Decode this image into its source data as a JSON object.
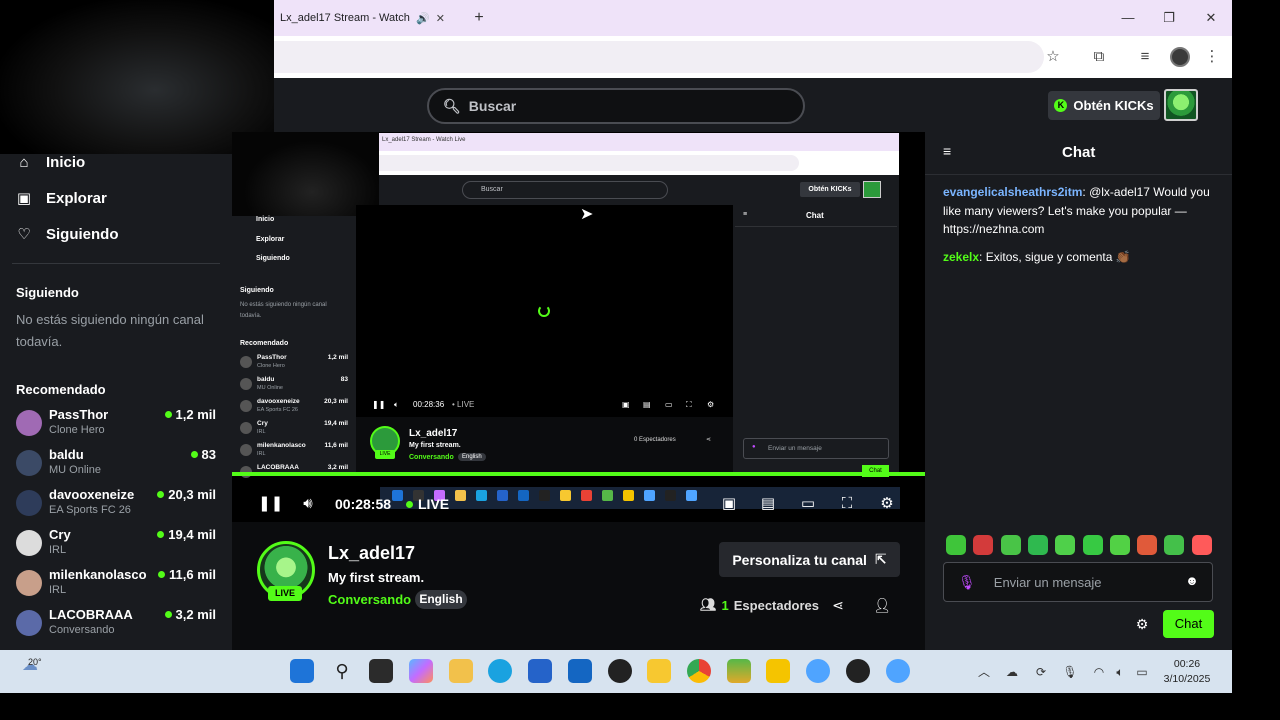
{
  "browser": {
    "tab_title": "Lx_adel17 Stream - Watch L",
    "tab_audio_icon": "speaker-icon",
    "close_glyph": "✕",
    "new_tab_glyph": "+",
    "min_glyph": "—",
    "restore_glyph": "❐",
    "winclose_glyph": "✕"
  },
  "header": {
    "search_placeholder": "Buscar",
    "kicks_label": "Obtén KICKs"
  },
  "sidebar": {
    "nav": [
      {
        "label": "Inicio",
        "icon": "home-icon"
      },
      {
        "label": "Explorar",
        "icon": "compass-icon"
      },
      {
        "label": "Siguiendo",
        "icon": "heart-icon"
      }
    ],
    "following_title": "Siguiendo",
    "following_empty": "No estás siguiendo ningún canal todavía.",
    "recommended_title": "Recomendado",
    "recommended": [
      {
        "name": "PassThor",
        "category": "Clone Hero",
        "viewers": "1,2 mil",
        "color": "#a06ab4"
      },
      {
        "name": "baldu",
        "category": "MU Online",
        "viewers": "83",
        "color": "#3b4a66"
      },
      {
        "name": "davooxeneize",
        "category": "EA Sports FC 26",
        "viewers": "20,3 mil",
        "color": "#2e3c5a"
      },
      {
        "name": "Cry",
        "category": "IRL",
        "viewers": "19,4 mil",
        "color": "#dcdcdc"
      },
      {
        "name": "milenkanolasco",
        "category": "IRL",
        "viewers": "11,6 mil",
        "color": "#c89f8a"
      },
      {
        "name": "LACOBRAAA",
        "category": "Conversando",
        "viewers": "3,2 mil",
        "color": "#5b6aa8"
      }
    ]
  },
  "player": {
    "time": "00:28:58",
    "live_label": "LIVE",
    "nested": {
      "tab_title": "Lx_adel17 Stream - Watch Live",
      "search": "Buscar",
      "kicks": "Obtén KICKs",
      "nav": [
        "Inicio",
        "Explorar",
        "Siguiendo"
      ],
      "following_title": "Siguiendo",
      "following_empty_1": "No estás siguiendo ningún canal",
      "following_empty_2": "todavía.",
      "recommended_title": "Recomendado",
      "rec": [
        {
          "name": "PassThor",
          "cat": "Clone Hero",
          "v": "1,2 mil"
        },
        {
          "name": "baldu",
          "cat": "MU Online",
          "v": "83"
        },
        {
          "name": "davooxeneize",
          "cat": "EA Sports FC 26",
          "v": "20,3 mil"
        },
        {
          "name": "Cry",
          "cat": "IRL",
          "v": "19,4 mil"
        },
        {
          "name": "milenkanolasco",
          "cat": "IRL",
          "v": "11,6 mil"
        },
        {
          "name": "LACOBRAAA",
          "cat": "",
          "v": "3,2 mil"
        }
      ],
      "time": "00:28:36",
      "live": "• LIVE",
      "chat_title": "Chat",
      "channel": "Lx_adel17",
      "title": "My first stream.",
      "category": "Conversando",
      "tag": "English",
      "live_badge": "LIVE",
      "viewers": "0 Espectadores",
      "input": "Enviar un mensaje",
      "chat_btn": "Chat"
    }
  },
  "channel": {
    "name": "Lx_adel17",
    "title": "My first stream.",
    "category": "Conversando",
    "tag": "English",
    "live_badge": "LIVE",
    "customize_label": "Personaliza tu canal",
    "viewers_count": "1",
    "viewers_label": "Espectadores"
  },
  "chat": {
    "title": "Chat",
    "messages": [
      {
        "user": "evangelicalsheathrs2itm",
        "text": ": @lx-adel17 Would you like many viewers? Let's make you popular — https://nezhna.com"
      },
      {
        "user": "zekelx",
        "text": ": Exitos, sigue y comenta 👏🏾"
      }
    ],
    "input_placeholder": "Enviar un mensaje",
    "send_label": "Chat",
    "emote_colors": [
      "#3fc53a",
      "#d33b3b",
      "#49c447",
      "#2fb94f",
      "#4fd04a",
      "#37c943",
      "#52d145",
      "#e05a3a",
      "#44c04a",
      "#ff5a5a"
    ]
  },
  "taskbar": {
    "weather": "20°",
    "time": "00:26",
    "date": "3/10/2025"
  }
}
